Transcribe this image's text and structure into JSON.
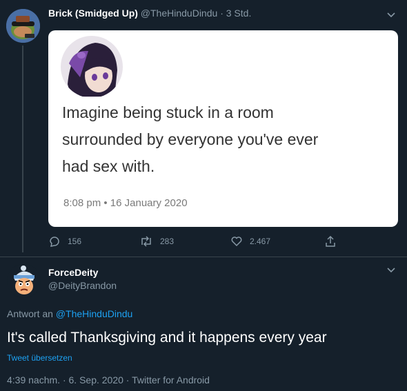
{
  "tweet1": {
    "display_name": "Brick (Smidged Up)",
    "handle": "@TheHinduDindu",
    "sep": "·",
    "time": "3 Std.",
    "embed": {
      "line1": "Imagine being stuck in a room",
      "line2": "surrounded by everyone you've ever",
      "line3": "had sex with.",
      "timestamp": "8:08 pm • 16 January 2020"
    },
    "replies": "156",
    "retweets": "283",
    "likes": "2.467"
  },
  "tweet2": {
    "display_name": "ForceDeity",
    "handle": "@DeityBrandon",
    "replying_prefix": "Antwort an ",
    "replying_handle": "@TheHinduDindu",
    "text": "It's called Thanksgiving and it happens every year",
    "translate": "Tweet übersetzen",
    "time": "4:39 nachm.",
    "sep1": " · ",
    "date": "6. Sep. 2020",
    "sep2": " · ",
    "source": "Twitter for Android"
  },
  "colors": {
    "background": "#15202b",
    "accent": "#1da1f2",
    "muted": "#8899a6",
    "divider": "#38444d"
  },
  "icons": [
    "caret-down-icon",
    "reply-icon",
    "retweet-icon",
    "like-icon",
    "share-icon",
    "avatar-brick",
    "avatar-forcedeity",
    "avatar-anime"
  ]
}
